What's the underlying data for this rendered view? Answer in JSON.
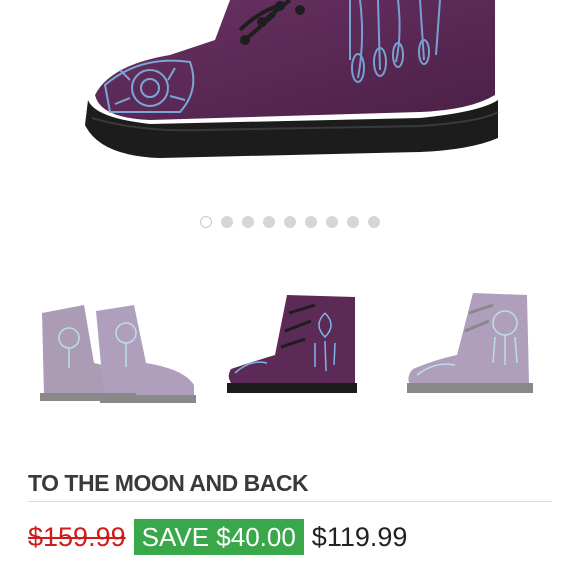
{
  "gallery": {
    "hero_alt": "purple dreamcatcher combat boot",
    "dot_count": 9,
    "active_index": 0,
    "thumbnails": [
      {
        "name": "thumb-pair"
      },
      {
        "name": "thumb-side"
      },
      {
        "name": "thumb-back"
      }
    ]
  },
  "product": {
    "title": "TO THE MOON AND BACK",
    "old_price": "$159.99",
    "save_label": "SAVE $40.00",
    "new_price": "$119.99"
  },
  "colors": {
    "boot_purple": "#5b2a56",
    "pattern_blue": "#7fb4e6",
    "sole_black": "#1c1c1c",
    "save_green": "#3aa84a",
    "strike_red": "#d11a1a"
  }
}
